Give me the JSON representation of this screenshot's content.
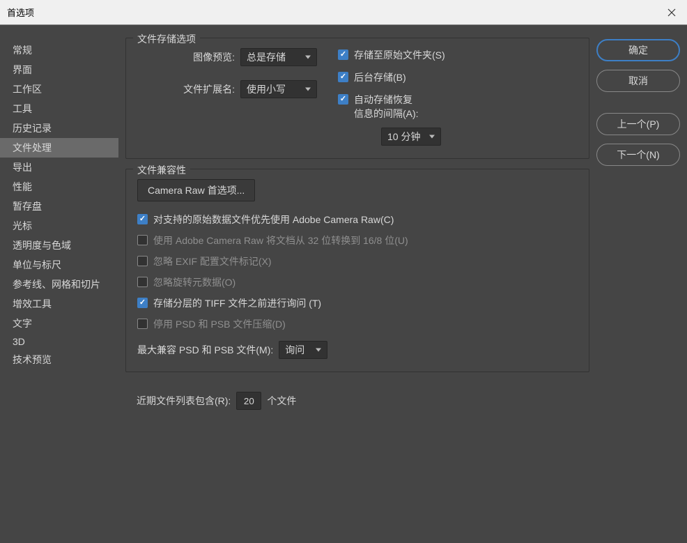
{
  "titlebar": {
    "title": "首选项"
  },
  "sidebar": {
    "items": [
      {
        "label": "常规",
        "key": "general"
      },
      {
        "label": "界面",
        "key": "interface"
      },
      {
        "label": "工作区",
        "key": "workspace"
      },
      {
        "label": "工具",
        "key": "tools"
      },
      {
        "label": "历史记录",
        "key": "history"
      },
      {
        "label": "文件处理",
        "key": "file-handling",
        "selected": true
      },
      {
        "label": "导出",
        "key": "export"
      },
      {
        "label": "性能",
        "key": "performance"
      },
      {
        "label": "暂存盘",
        "key": "scratch"
      },
      {
        "label": "光标",
        "key": "cursor"
      },
      {
        "label": "透明度与色域",
        "key": "transparency"
      },
      {
        "label": "单位与标尺",
        "key": "units"
      },
      {
        "label": "参考线、网格和切片",
        "key": "guides"
      },
      {
        "label": "增效工具",
        "key": "plugins"
      },
      {
        "label": "文字",
        "key": "type"
      },
      {
        "label": "3D",
        "key": "3d"
      },
      {
        "label": "技术预览",
        "key": "tech-preview"
      }
    ]
  },
  "buttons": {
    "ok": "确定",
    "cancel": "取消",
    "prev": "上一个(P)",
    "next": "下一个(N)"
  },
  "storage": {
    "title": "文件存储选项",
    "imagePreviewLabel": "图像预览:",
    "imagePreviewValue": "总是存储",
    "fileExtLabel": "文件扩展名:",
    "fileExtValue": "使用小写",
    "saveOriginal": "存储至原始文件夹(S)",
    "backgroundSave": "后台存储(B)",
    "autoSave": "自动存储恢复\n信息的间隔(A):",
    "autoSaveLine1": "自动存储恢复",
    "autoSaveLine2": "信息的间隔(A):",
    "intervalValue": "10 分钟"
  },
  "compat": {
    "title": "文件兼容性",
    "cameraRawBtn": "Camera Raw 首选项...",
    "preferRaw": "对支持的原始数据文件优先使用 Adobe Camera Raw(C)",
    "use32to16": "使用 Adobe Camera Raw 将文档从 32 位转换到 16/8 位(U)",
    "ignoreExif": "忽略 EXIF 配置文件标记(X)",
    "ignoreRotation": "忽略旋转元数据(O)",
    "askTiff": "存储分层的 TIFF 文件之前进行询问  (T)",
    "disablePsd": "停用 PSD 和 PSB 文件压缩(D)",
    "maxCompatLabel": "最大兼容 PSD 和 PSB 文件(M):",
    "maxCompatValue": "询问"
  },
  "recent": {
    "label": "近期文件列表包含(R):",
    "value": "20",
    "suffix": "个文件"
  }
}
